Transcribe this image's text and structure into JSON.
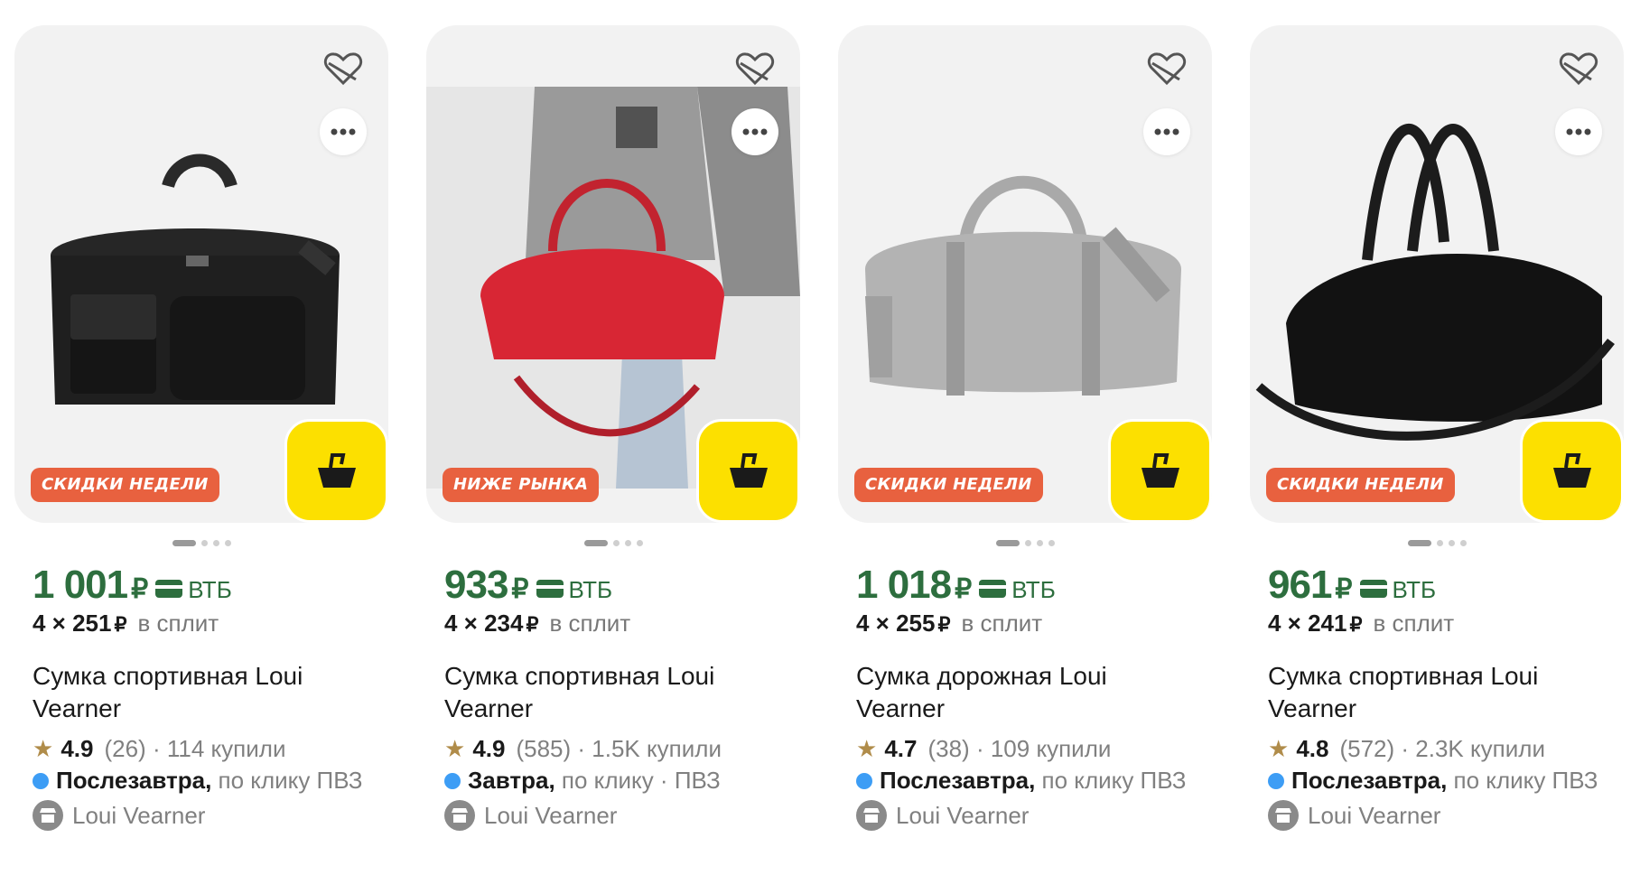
{
  "colors": {
    "price_green": "#2d6e3e",
    "badge_orange": "#e8613f",
    "cart_yellow": "#fce000",
    "delivery_blue": "#3d9df5",
    "card_bg": "#f2f2f2"
  },
  "icons": [
    "heart-icon",
    "more-dots-icon",
    "cart-basket-icon",
    "bank-card-icon",
    "star-icon",
    "shop-icon"
  ],
  "products": [
    {
      "badge": "СКИДКИ НЕДЕЛИ",
      "image": "black-sports-bag",
      "price": "1 001",
      "currency": "₽",
      "bank": "ВТБ",
      "split_mult": "4 × 251",
      "split_cur": "₽",
      "split_text": "в сплит",
      "title": "Сумка спортивная Loui Vearner",
      "rating": "4.9",
      "reviews": "(26)",
      "bought": "· 114 купили",
      "delivery_day": "Послезавтра,",
      "delivery_rest": "по клику ПВЗ",
      "seller": "Loui Vearner",
      "dots": 4,
      "active_dot": 0
    },
    {
      "badge": "НИЖЕ РЫНКА",
      "image": "red-sports-bag",
      "price": "933",
      "currency": "₽",
      "bank": "ВТБ",
      "split_mult": "4 × 234",
      "split_cur": "₽",
      "split_text": "в сплит",
      "title": "Сумка спортивная Loui Vearner",
      "rating": "4.9",
      "reviews": "(585)",
      "bought": "· 1.5K купили",
      "delivery_day": "Завтра,",
      "delivery_rest": "по клику · ПВЗ",
      "seller": "Loui Vearner",
      "dots": 4,
      "active_dot": 0
    },
    {
      "badge": "СКИДКИ НЕДЕЛИ",
      "image": "grey-travel-bag",
      "price": "1 018",
      "currency": "₽",
      "bank": "ВТБ",
      "split_mult": "4 × 255",
      "split_cur": "₽",
      "split_text": "в сплит",
      "title": "Сумка дорожная Loui Vearner",
      "rating": "4.7",
      "reviews": "(38)",
      "bought": "· 109 купили",
      "delivery_day": "Послезавтра,",
      "delivery_rest": "по клику ПВЗ",
      "seller": "Loui Vearner",
      "dots": 4,
      "active_dot": 0
    },
    {
      "badge": "СКИДКИ НЕДЕЛИ",
      "image": "black-duffel-bag",
      "price": "961",
      "currency": "₽",
      "bank": "ВТБ",
      "split_mult": "4 × 241",
      "split_cur": "₽",
      "split_text": "в сплит",
      "title": "Сумка спортивная Loui Vearner",
      "rating": "4.8",
      "reviews": "(572)",
      "bought": "· 2.3K купили",
      "delivery_day": "Послезавтра,",
      "delivery_rest": "по клику ПВЗ",
      "seller": "Loui Vearner",
      "dots": 4,
      "active_dot": 0
    }
  ]
}
